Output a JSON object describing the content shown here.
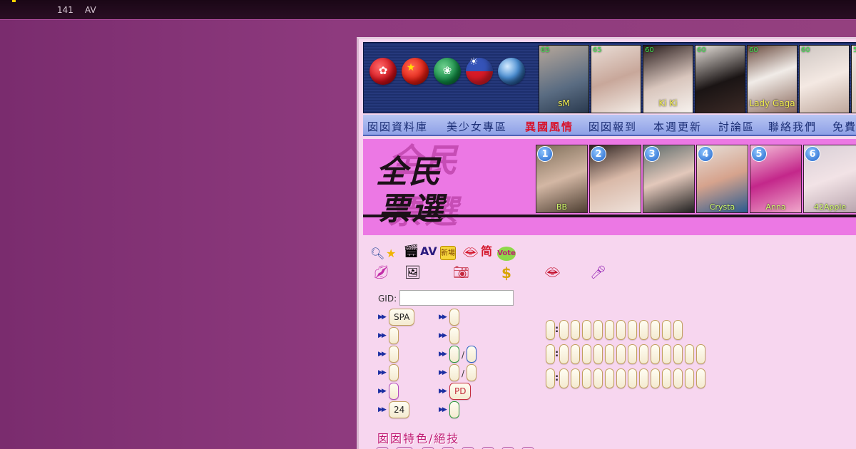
{
  "topbar": {
    "count": "141",
    "label": "AV"
  },
  "gid": {
    "label": "GID:",
    "value": ""
  },
  "flags": [
    {
      "name": "hong-kong-flag-icon",
      "glyph": "✿"
    },
    {
      "name": "china-flag-icon",
      "glyph": "★"
    },
    {
      "name": "macau-flag-icon",
      "glyph": "❀"
    },
    {
      "name": "taiwan-flag-icon",
      "glyph": "☀"
    },
    {
      "name": "globe-icon",
      "glyph": ""
    }
  ],
  "thumbs": [
    {
      "score": "65",
      "name": "sM"
    },
    {
      "score": "65",
      "name": ""
    },
    {
      "score": "60",
      "name": "Ki Ki"
    },
    {
      "score": "60",
      "name": ""
    },
    {
      "score": "60",
      "name": "Lady Gaga"
    },
    {
      "score": "60",
      "name": ""
    },
    {
      "score": "5",
      "name": ""
    }
  ],
  "nav": [
    {
      "label": "囡囡資料庫"
    },
    {
      "label": "美少女專區"
    },
    {
      "label": "異國風情"
    },
    {
      "label": "囡囡報到"
    },
    {
      "label": "本週更新"
    },
    {
      "label": "討論區"
    },
    {
      "label": "聯絡我們"
    },
    {
      "label": "免費"
    }
  ],
  "vote": {
    "title_line1": "全民",
    "title_line2": "票選",
    "ranks": [
      {
        "rank": "1",
        "name": "BB"
      },
      {
        "rank": "2",
        "name": ""
      },
      {
        "rank": "3",
        "name": ""
      },
      {
        "rank": "4",
        "name": "Crysta"
      },
      {
        "rank": "5",
        "name": "Anna"
      },
      {
        "rank": "6",
        "name": "42Apple"
      }
    ]
  },
  "icons": {
    "av_label": "AV",
    "simplified_label": "简",
    "vote_label": "Vote",
    "new_label": "新場",
    "dollar_label": "$"
  },
  "filters": {
    "left": [
      "SPA",
      "",
      "",
      "",
      "",
      "24"
    ],
    "right": [
      "",
      "",
      "",
      "",
      "PD",
      ""
    ],
    "slash": "/"
  },
  "feature_label": "囡囡特色/絕技",
  "colors": {
    "background": "#8e3a7e",
    "nav_text": "#1b2e75",
    "hot": "#d8132b",
    "vote_banner": "#ec78e4",
    "feature": "#c01873"
  }
}
